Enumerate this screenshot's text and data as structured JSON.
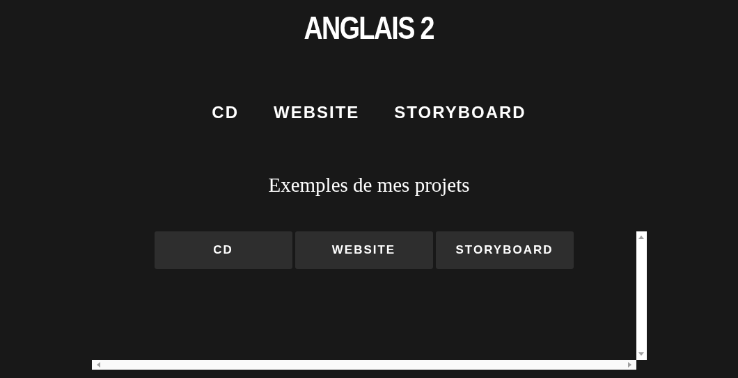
{
  "title": "ANGLAIS 2",
  "nav": [
    "CD",
    "WEBSITE",
    "STORYBOARD"
  ],
  "subtitle": "Exemples de mes projets",
  "frame": {
    "tabs": [
      "CD",
      "WEBSITE",
      "STORYBOARD"
    ]
  }
}
